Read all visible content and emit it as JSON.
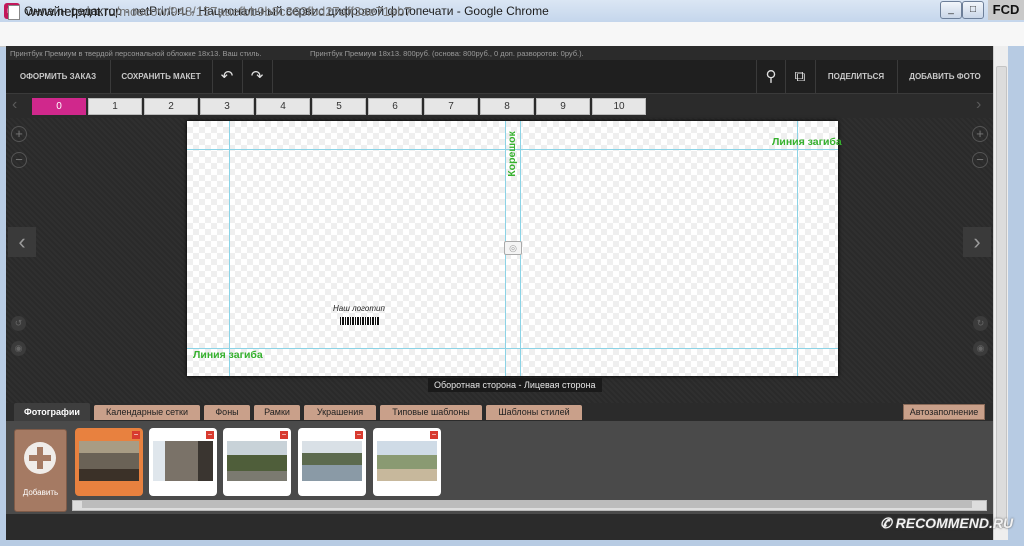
{
  "window": {
    "title": "Онлайн-редактор - netPrint.ru - Национальный сервис цифровой фотопечати - Google Chrome",
    "controls": [
      "_",
      "□",
      "✕"
    ],
    "badge": "FCD"
  },
  "address": {
    "host": "www.netprint.ru",
    "path": "/moscow/948/157aaefbb9b8c363fbd27aff3ae71eb7"
  },
  "info": {
    "left": "Принтбук Премиум в твердой персональной обложке 18x13. Ваш стиль.",
    "right": "Принтбук Премиум 18x13. 800руб. (основа: 800руб., 0 доп. разворотов: 0руб.)."
  },
  "toolbar": {
    "order": "ОФОРМИТЬ ЗАКАЗ",
    "save": "СОХРАНИТЬ МАКЕТ",
    "undo": "↶",
    "redo": "↷",
    "search": "⚲",
    "layout": "⧉",
    "share": "ПОДЕЛИТЬСЯ",
    "add_photo": "ДОБАВИТЬ ФОТО"
  },
  "page_tabs": [
    "0",
    "1",
    "2",
    "3",
    "4",
    "5",
    "6",
    "7",
    "8",
    "9",
    "10"
  ],
  "canvas": {
    "fold_line_top": "Линия загиба",
    "fold_line_bottom": "Линия загиба",
    "spine": "Корешок",
    "logo": "Наш логотип",
    "caption": "Оборотная сторона - Лицевая сторона"
  },
  "bottom_tabs": [
    "Фотографии",
    "Календарные сетки",
    "Фоны",
    "Рамки",
    "Украшения",
    "Типовые шаблоны",
    "Шаблоны стилей"
  ],
  "autofill": "Автозаполнение",
  "add_label": "Добавить",
  "thumbnails": [
    {
      "name": "photo-colosseum",
      "colors": [
        "#6a6256",
        "#a89c84",
        "#3b3128"
      ]
    },
    {
      "name": "photo-temple",
      "colors": [
        "#dfe6ec",
        "#7a7268",
        "#3a3530"
      ]
    },
    {
      "name": "photo-trees",
      "colors": [
        "#c8d2d8",
        "#4f5e3a",
        "#7b7a70"
      ]
    },
    {
      "name": "photo-canal",
      "colors": [
        "#d9e0e6",
        "#5c6a4e",
        "#8a9aa6"
      ]
    },
    {
      "name": "photo-panorama",
      "colors": [
        "#cfdbe6",
        "#8a9a72",
        "#c7b89c"
      ]
    }
  ],
  "watermark": "✆ RECOMMEND.RU"
}
